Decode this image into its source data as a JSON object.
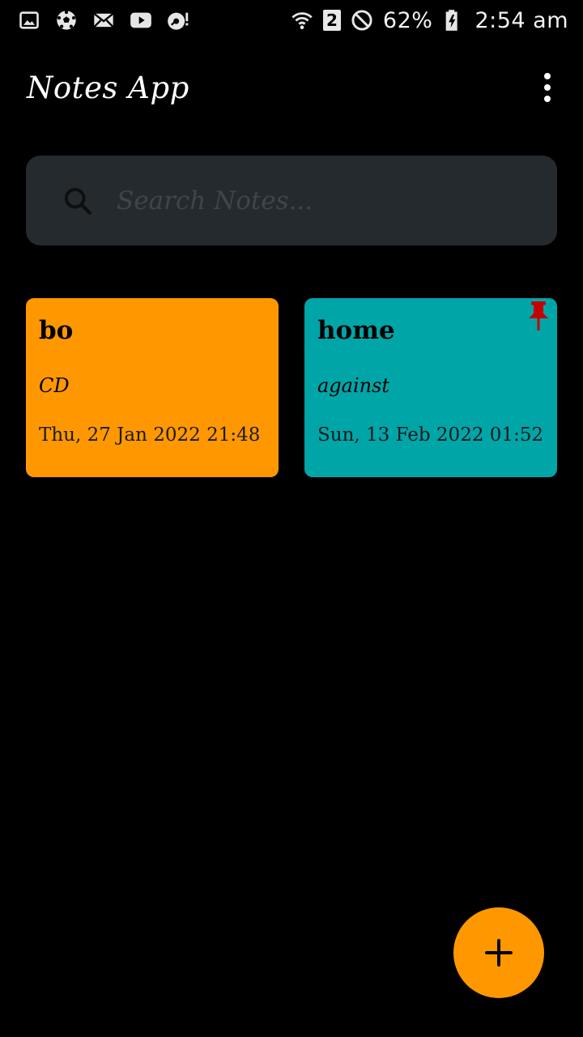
{
  "status_bar": {
    "battery": "62%",
    "time": "2:54 am",
    "sim_slot": "2",
    "icons_left": [
      "gallery-icon",
      "soccer-ball-icon",
      "mail-icon",
      "youtube-icon",
      "disc-alert-icon"
    ],
    "icons_right": [
      "wifi-icon",
      "sim-2-icon",
      "do-not-disturb-icon",
      "battery-charging-icon"
    ]
  },
  "app_bar": {
    "title": "Notes App",
    "menu_icon": "more-vertical-icon"
  },
  "search": {
    "placeholder": "Search Notes...",
    "value": "",
    "icon": "search-icon"
  },
  "notes": [
    {
      "title": "bo",
      "body": "CD",
      "date": "Thu, 27 Jan 2022 21:48 p",
      "color": "#ff9800",
      "pinned": false
    },
    {
      "title": "home",
      "body": "against",
      "date": "Sun, 13 Feb 2022 01:52 a",
      "color": "#00a5a8",
      "pinned": true,
      "pin_icon": "pushpin-icon",
      "pin_color": "#c40000"
    }
  ],
  "fab": {
    "icon": "plus-icon",
    "color": "#ff9800"
  }
}
